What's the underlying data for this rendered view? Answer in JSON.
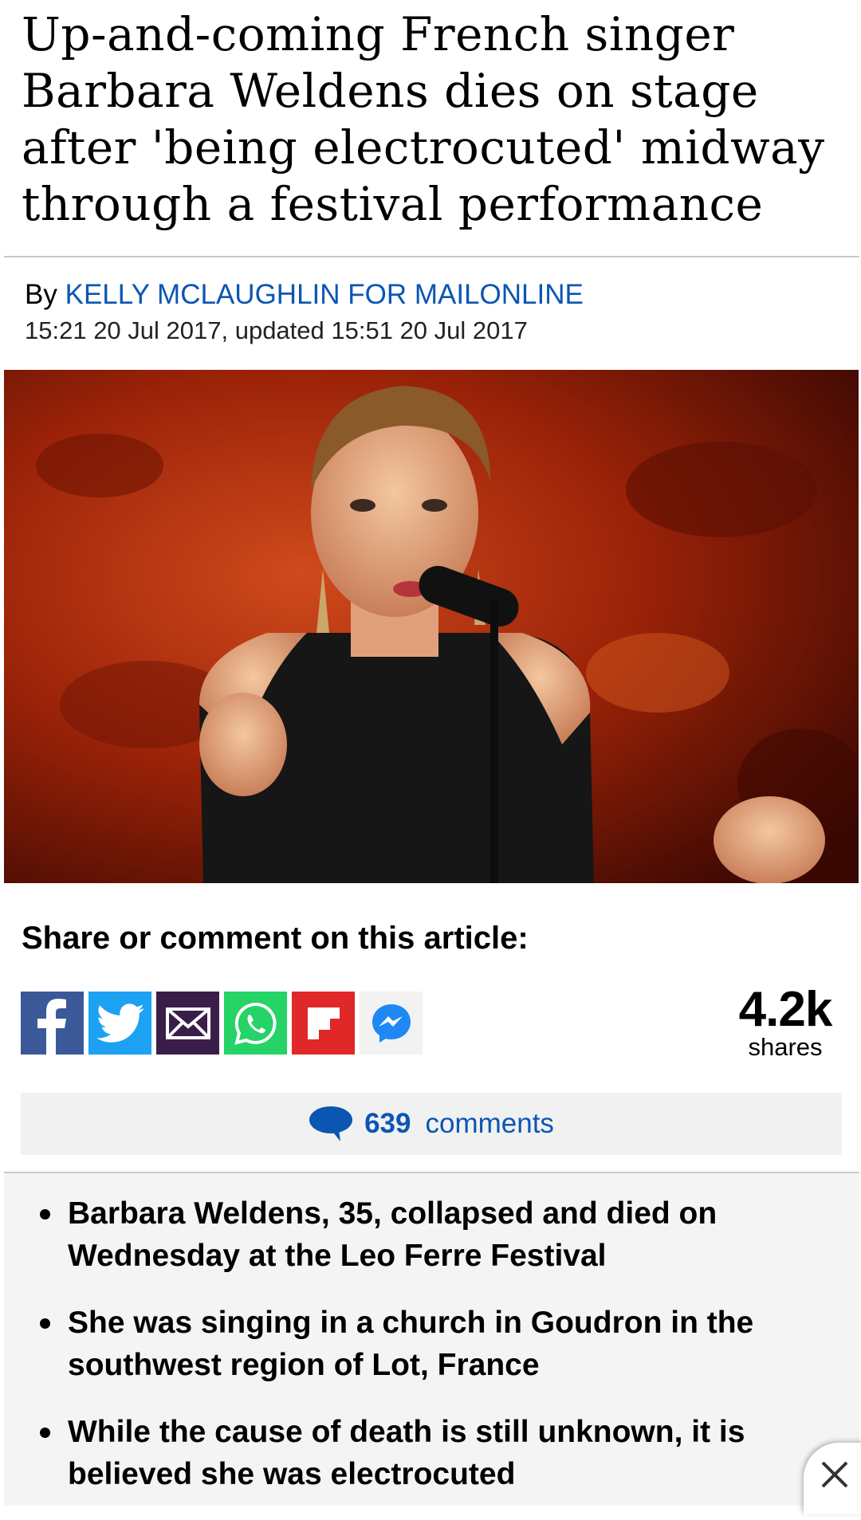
{
  "article": {
    "headline": "Up-and-coming French singer Barbara Weldens dies on stage after 'being electrocuted' midway through a festival performance",
    "by_prefix": "By",
    "author": "KELLY MCLAUGHLIN FOR MAILONLINE",
    "dateline": "15:21 20 Jul 2017, updated 15:51 20 Jul 2017"
  },
  "share": {
    "title": "Share or comment on this article:",
    "buttons": [
      {
        "icon": "facebook-icon",
        "color": "#3b5998"
      },
      {
        "icon": "twitter-icon",
        "color": "#1da1f2"
      },
      {
        "icon": "email-icon",
        "color": "#3a1e4a"
      },
      {
        "icon": "whatsapp-icon",
        "color": "#25d366"
      },
      {
        "icon": "flipboard-icon",
        "color": "#e12828"
      },
      {
        "icon": "messenger-icon",
        "color": "#f2f2f2"
      }
    ],
    "count": "4.2k",
    "count_label": "shares"
  },
  "comments": {
    "count": "639",
    "label": "comments",
    "icon": "speech-bubble-icon"
  },
  "bullets": [
    "Barbara Weldens, 35, collapsed and died on Wednesday at the Leo Ferre Festival",
    "She was singing in a church in Goudron in the southwest region of Lot, France",
    "While the cause of death is still unknown, it is believed she was electrocuted"
  ],
  "colors": {
    "link": "#0b56b2",
    "rule": "#c8c8c8"
  }
}
